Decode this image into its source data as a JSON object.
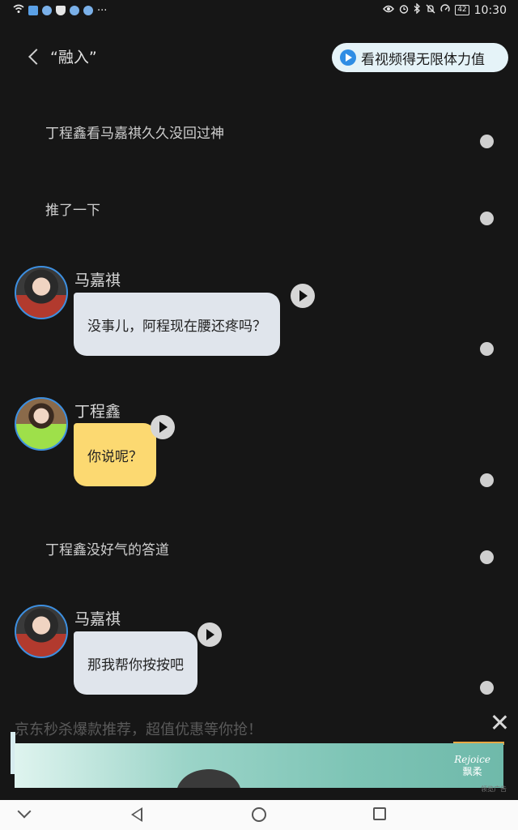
{
  "status_bar": {
    "time": "10:30",
    "battery": "42",
    "left_icons": [
      "wifi-icon",
      "message-icon",
      "app-icon",
      "shield-icon",
      "app-icon",
      "app-icon",
      "more-icon"
    ],
    "right_icons": [
      "eye-icon",
      "alarm-icon",
      "bluetooth-icon",
      "mute-icon",
      "speed-icon",
      "battery-icon"
    ],
    "more": "···"
  },
  "header": {
    "title": "“融入”",
    "ad_pill_label": "看视频得无限体力值"
  },
  "chat": {
    "narration_1": "丁程鑫看马嘉祺久久没回过神",
    "narration_2": "推了一下",
    "msg_1": {
      "speaker": "马嘉祺",
      "text": "没事儿，阿程现在腰还疼吗？"
    },
    "msg_2": {
      "speaker": "丁程鑫",
      "text": "你说呢？"
    },
    "narration_3": "丁程鑫没好气的答道",
    "msg_3": {
      "speaker": "马嘉祺",
      "text": "那我帮你按按吧"
    }
  },
  "ad": {
    "text": "京东秒杀爆款推荐，超值优惠等你抢！",
    "brand_name": "Rejoice",
    "brand_cn": "飘柔",
    "footer": "领览广告"
  },
  "colors": {
    "background": "#161616",
    "bubble_grey": "#e0e5ec",
    "bubble_yellow": "#fcd971",
    "avatar_ring": "#3d8fe0",
    "ad_pill": "#e5f3f8"
  }
}
